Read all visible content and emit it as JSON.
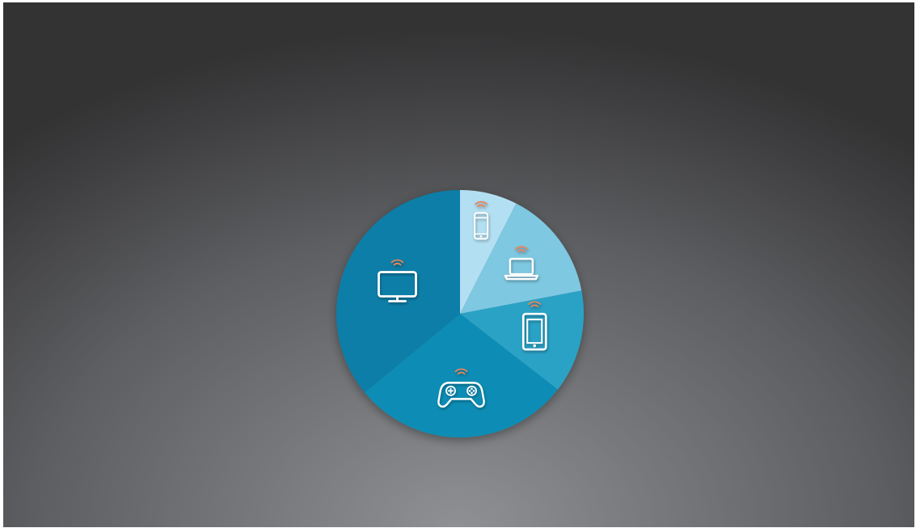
{
  "chart_data": {
    "type": "pie",
    "title": "",
    "start_angle_deg": 0,
    "direction": "clockwise",
    "slices": [
      {
        "icon": "smartphone-icon",
        "value": 7.5,
        "color": "#b3dff2"
      },
      {
        "icon": "laptop-icon",
        "value": 14.5,
        "color": "#7ec8e1"
      },
      {
        "icon": "tablet-icon",
        "value": 13.5,
        "color": "#2ba2c6"
      },
      {
        "icon": "game-controller-icon",
        "value": 28.5,
        "color": "#0a8db5"
      },
      {
        "icon": "television-icon",
        "value": 36.0,
        "color": "#087ea8"
      }
    ],
    "wifi_icon_color": "#e8845a",
    "legend": "none"
  }
}
